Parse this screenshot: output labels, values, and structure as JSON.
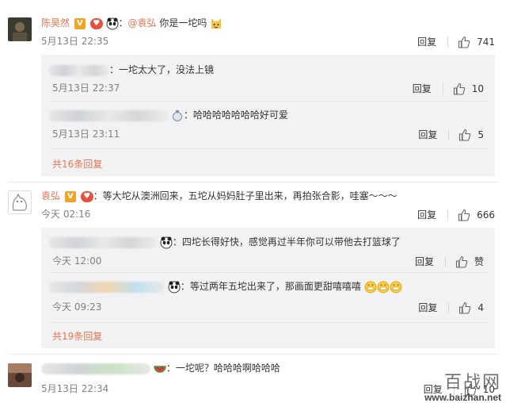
{
  "comments": [
    {
      "user": "陈昊然",
      "text_prefix": "：",
      "mention": "@袁弘",
      "text": " 你是一坨吗",
      "time": "5月13日 22:35",
      "reply_label": "回复",
      "likes": "741",
      "replies": [
        {
          "text": "：一坨太大了，没法上镜",
          "time": "5月13日 22:37",
          "reply_label": "回复",
          "likes": "10"
        },
        {
          "text": "：哈哈哈哈哈哈哈好可爱",
          "time": "5月13日 23:11",
          "reply_label": "回复",
          "likes": "5"
        }
      ],
      "total_replies": "共16条回复"
    },
    {
      "user": "袁弘",
      "text": "：等大坨从澳洲回来，五坨从妈妈肚子里出来，再拍张合影，哇塞～～～",
      "time": "今天 02:16",
      "reply_label": "回复",
      "likes": "666",
      "replies": [
        {
          "text": "：四坨长得好快，感觉再过半年你可以带他去打篮球了",
          "time": "今天 12:00",
          "reply_label": "回复",
          "likes": "赞"
        },
        {
          "text": "：等过两年五坨出来了，那画面更甜嘻嘻嘻",
          "time": "今天 09:23",
          "reply_label": "回复",
          "likes": "4"
        }
      ],
      "total_replies": "共19条回复"
    },
    {
      "text": "：一坨呢？哈哈哈啊哈哈哈",
      "time": "5月13日 22:34",
      "reply_label": "回复",
      "likes": "10"
    }
  ],
  "watermark": {
    "title": "百战网",
    "url": "www.baizhan.net"
  },
  "colors": {
    "link": "#eb7350",
    "sub_background": "#f2f2f5",
    "time": "#808080"
  },
  "icons": [
    "thumbs-up-icon",
    "verified-v-icon",
    "heart-badge-icon",
    "panda-emoji-icon",
    "cat-emoji-icon",
    "grin-emoji-icon",
    "watermelon-emoji-icon"
  ]
}
